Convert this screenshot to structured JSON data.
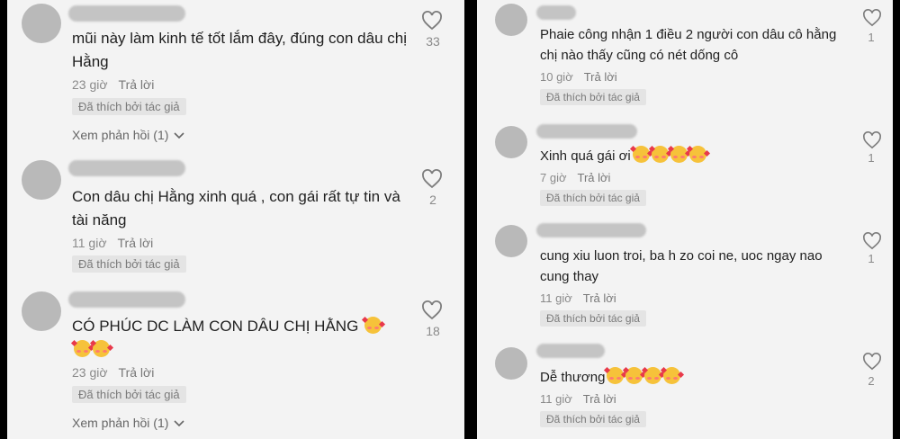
{
  "left": {
    "comments": [
      {
        "text": "mũi này làm kinh tế tốt lắm đây, đúng con dâu chị Hằng",
        "emojis": 0,
        "time": "23 giờ",
        "reply": "Trả lời",
        "liked": "Đã thích bởi tác giả",
        "view_more": "Xem phản hồi (1)",
        "likes": "33"
      },
      {
        "text": "Con dâu chị Hằng xinh quá , con gái rất tự tin và tài năng",
        "emojis": 0,
        "time": "11 giờ",
        "reply": "Trả lời",
        "liked": "Đã thích bởi tác giả",
        "view_more": "",
        "likes": "2"
      },
      {
        "text": "CÓ PHÚC DC LÀM CON DÂU CHỊ HẰNG",
        "emojis": 3,
        "time": "23 giờ",
        "reply": "Trả lời",
        "liked": "Đã thích bởi tác giả",
        "view_more": "Xem phản hồi (1)",
        "likes": "18"
      }
    ]
  },
  "right": {
    "comments": [
      {
        "text": "Phaie công nhận 1 điều 2 người con dâu cô hằng chị nào thấy cũng có nét dống cô",
        "emojis": 0,
        "time": "10 giờ",
        "reply": "Trả lời",
        "liked": "Đã thích bởi tác giả",
        "likes": "1"
      },
      {
        "text": "Xinh quá gái ơi",
        "emojis": 4,
        "time": "7 giờ",
        "reply": "Trả lời",
        "liked": "Đã thích bởi tác giả",
        "likes": "1"
      },
      {
        "text": "cung xiu luon troi, ba h zo coi ne, uoc ngay nao cung thay",
        "emojis": 0,
        "time": "11 giờ",
        "reply": "Trả lời",
        "liked": "Đã thích bởi tác giả",
        "likes": "1"
      },
      {
        "text": "Dễ thương",
        "emojis": 4,
        "time": "11 giờ",
        "reply": "Trả lời",
        "liked": "Đã thích bởi tác giả",
        "likes": "2"
      }
    ]
  },
  "icons": {
    "like": "heart-outline-icon",
    "reaction": "smiling-face-with-hearts-icon",
    "expand": "chevron-down-icon"
  },
  "colors": {
    "background": "#f3f3f3",
    "divider": "#000000",
    "liked_badge": "#e4e4e4",
    "muted_text": "#8a8a8a"
  }
}
